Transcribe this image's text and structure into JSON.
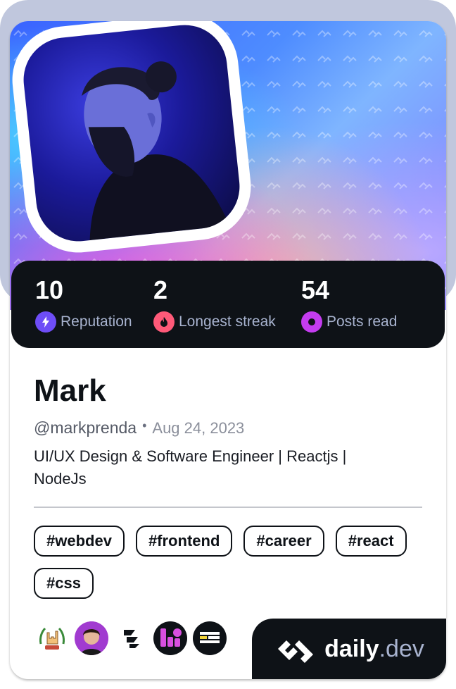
{
  "profile": {
    "name": "Mark",
    "handle": "@markprenda",
    "joined": "Aug 24, 2023",
    "bio": "UI/UX Design & Software Engineer | Reactjs | NodeJs"
  },
  "stats": [
    {
      "value": "10",
      "label": "Reputation",
      "icon": "lightning-icon",
      "color": "#6e4df7"
    },
    {
      "value": "2",
      "label": "Longest streak",
      "icon": "flame-icon",
      "color": "#ff5a79"
    },
    {
      "value": "54",
      "label": "Posts read",
      "icon": "eye-ring-icon",
      "color": "#c43cf0"
    }
  ],
  "tags": [
    "#webdev",
    "#frontend",
    "#career",
    "#react",
    "#css"
  ],
  "badges": [
    "rock-hand-badge",
    "avatar-badge",
    "stacked-logo-badge",
    "u-logo-badge",
    "it-takes-badge"
  ],
  "brand": {
    "name": "daily",
    "suffix": ".dev"
  },
  "colors": {
    "dark": "#0e1217",
    "muted": "#a8b3cf",
    "frame": "#c0c7dd"
  }
}
